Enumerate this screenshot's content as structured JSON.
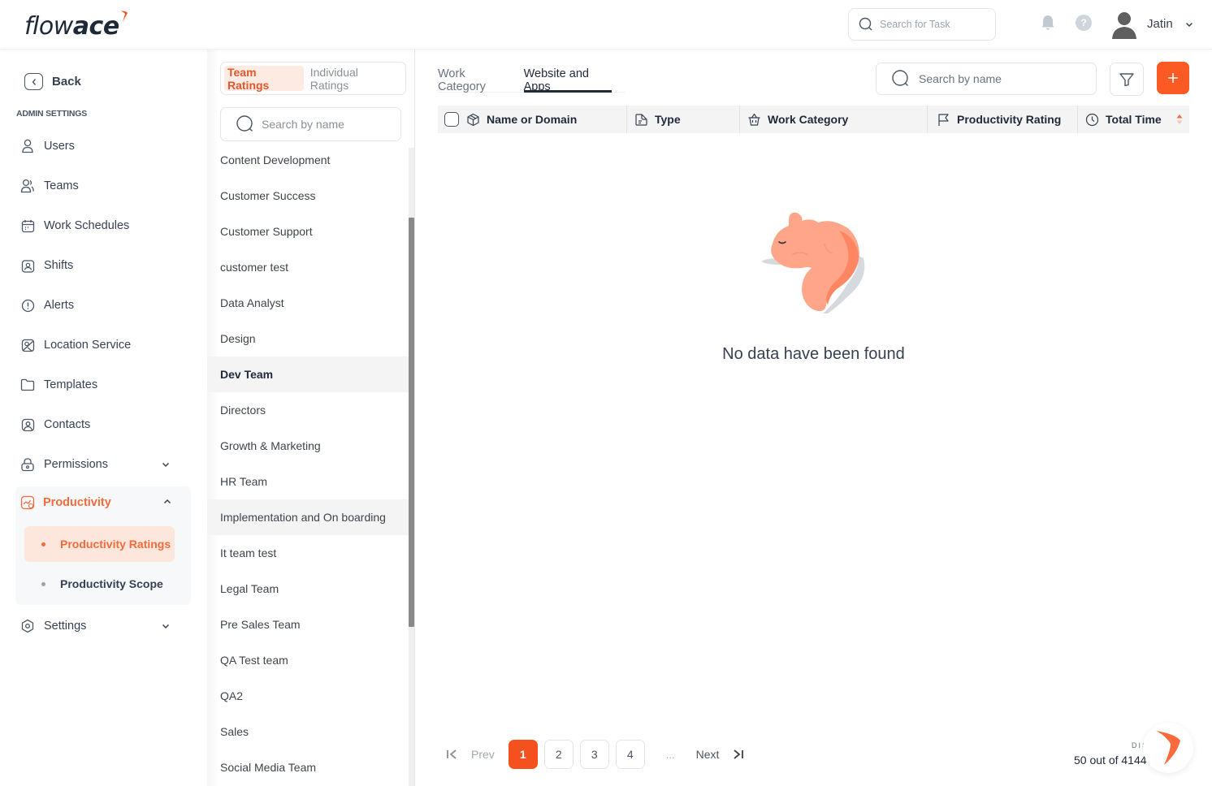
{
  "header": {
    "logo_light": "flow",
    "logo_bold": "ace",
    "task_search_placeholder": "Search for Task",
    "user_name": "Jatin",
    "help_label": "?"
  },
  "sidebar": {
    "back_label": "Back",
    "section_title": "ADMIN SETTINGS",
    "items": [
      {
        "label": "Users",
        "icon": "user-icon"
      },
      {
        "label": "Teams",
        "icon": "team-icon"
      },
      {
        "label": "Work Schedules",
        "icon": "calendar-icon"
      },
      {
        "label": "Shifts",
        "icon": "shift-badge-icon"
      },
      {
        "label": "Alerts",
        "icon": "alert-icon"
      },
      {
        "label": "Location Service",
        "icon": "location-map-icon"
      },
      {
        "label": "Templates",
        "icon": "folder-icon"
      },
      {
        "label": "Contacts",
        "icon": "contact-icon"
      },
      {
        "label": "Permissions",
        "icon": "lock-icon",
        "expandable": true
      },
      {
        "label": "Productivity",
        "icon": "productivity-icon",
        "expanded": true,
        "active": true
      },
      {
        "label": "Settings",
        "icon": "settings-icon",
        "expandable": true
      }
    ],
    "productivity_sub": [
      {
        "label": "Productivity Ratings",
        "active": true
      },
      {
        "label": "Productivity Scope",
        "active": false
      }
    ]
  },
  "team_panel": {
    "toggle": [
      {
        "label": "Team Ratings",
        "active": true
      },
      {
        "label": "Individual Ratings",
        "active": false
      }
    ],
    "search_placeholder": "Search by name",
    "teams": [
      "Content Development",
      "Customer Success",
      "Customer Support",
      "customer test",
      "Data Analyst",
      "Design",
      "Dev Team",
      "Directors",
      "Growth & Marketing",
      "HR Team",
      "Implementation and On boarding",
      "It team test",
      "Legal Team",
      "Pre Sales Team",
      "QA Test team",
      "QA2",
      "Sales",
      "Social Media Team"
    ],
    "selected_team": "Dev Team",
    "hovered_team": "Implementation and On boarding"
  },
  "main": {
    "tabs": [
      {
        "label": "Work Category",
        "active": false
      },
      {
        "label": "Website and Apps",
        "active": true
      }
    ],
    "search_placeholder": "Search by name",
    "add_label": "+",
    "columns": [
      {
        "label": "Name or Domain",
        "icon": "cube-icon"
      },
      {
        "label": "Type",
        "icon": "document-icon"
      },
      {
        "label": "Work Category",
        "icon": "basket-icon"
      },
      {
        "label": "Productivity Rating",
        "icon": "flag-icon"
      },
      {
        "label": "Total Time",
        "icon": "clock-icon",
        "sortable": true
      }
    ],
    "empty_message": "No data have been found",
    "pagination": {
      "prev_label": "Prev",
      "next_label": "Next",
      "pages": [
        "1",
        "2",
        "3",
        "4"
      ],
      "current_page": "1",
      "ellipsis": "..."
    },
    "display_label": "DIS",
    "display_count": "50 out of 4144"
  },
  "colors": {
    "brand": "#f4511e",
    "accent_text": "#f26b3a",
    "active_sub_bg": "#fde6dc"
  }
}
